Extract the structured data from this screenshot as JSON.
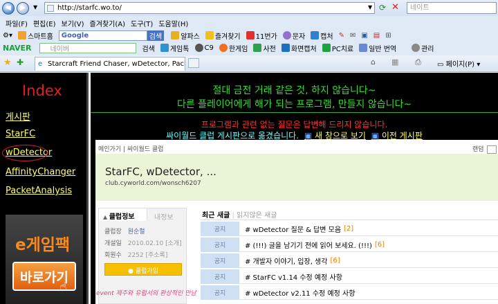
{
  "browser": {
    "url": "http://starfc.wo.to/",
    "search_placeholder": "네이트",
    "menus": [
      "파일(F)",
      "편집(E)",
      "보기(V)",
      "즐겨찾기(A)",
      "도구(T)",
      "도움말(H)"
    ],
    "toolbar1": [
      "스마트홈",
      "Google",
      "검색",
      "알파스",
      "즐겨찾기",
      "11번가",
      "문자",
      "캡처"
    ],
    "toolbar2": {
      "brand": "NAVER",
      "search_placeholder": "네이버",
      "search_label": "검색",
      "items": [
        "게임톡",
        "C9",
        "한게임",
        "사전",
        "화면캡처",
        "PC치료",
        "일반 번역",
        "관리"
      ]
    },
    "tab_title": "Starcraft Friend Chaser, wDetector, Packet A...",
    "tab_tools": [
      "페이지(P)"
    ]
  },
  "sidebar": {
    "title": "Index",
    "links": [
      "게시판",
      "StarFC",
      "wDetector",
      "AffinityChanger",
      "PacketAnalysis"
    ],
    "ad_title": "e게임팩",
    "ad_button": "바로가기"
  },
  "banner": {
    "line1": "절대 금전 거래 같은 것, 하지 않습니다~",
    "line2": "다른 플레이어에게 해가 되는 프로그램, 만들지 않습니다~",
    "warning": "프로그램과 관련 없는 질문은 답변해 드리지 않습니다.",
    "notice": "싸이월드 클럽 게시판으로 옮겼습니다.",
    "link_new": "새 창으로 보기",
    "link_old": "이전 게시판"
  },
  "cafe": {
    "topnav": [
      "메인가기",
      "싸이월드 클럽"
    ],
    "topnav_right": "랜덤",
    "title": "StarFC, wDetector, ...",
    "url": "club.cyworld.com/wonsch6207",
    "tabs": [
      "클럽정보",
      "내정보"
    ],
    "info": [
      {
        "label": "클럽장",
        "value": "원순철"
      },
      {
        "label": "개설일",
        "value": "2010.02.10 [소개]"
      },
      {
        "label": "회원수",
        "value": "2252 [주소록]"
      }
    ],
    "join_button": "클럽가입",
    "event_text": "event 제주와 유럽서의 환상적인 만남",
    "post_tabs": [
      "최근 새글",
      "읽지않은 새글"
    ],
    "posts": [
      {
        "badge": "공지",
        "title": "# wDetector 질문 & 답변 모음",
        "count": "[2]"
      },
      {
        "badge": "공지",
        "title": "# (!!!) 글을 남기기 전에 읽어 보세요. (!!!)",
        "count": "[6]"
      },
      {
        "badge": "공지",
        "title": "# 개발자 이야기, 입장, 생각",
        "count": "[6]"
      },
      {
        "badge": "공지",
        "title": "# StarFC v1.14 수정 예정 사항",
        "count": ""
      },
      {
        "badge": "공지",
        "title": "# wDetector v2.11 수정 예정 사항",
        "count": ""
      }
    ]
  },
  "colors": {
    "sidebar_link": "#ffff66",
    "banner_green": "#33dd33",
    "warning_red": "#ff3333",
    "notice_cyan": "#66ffff",
    "link_yellow": "#ffff66"
  }
}
